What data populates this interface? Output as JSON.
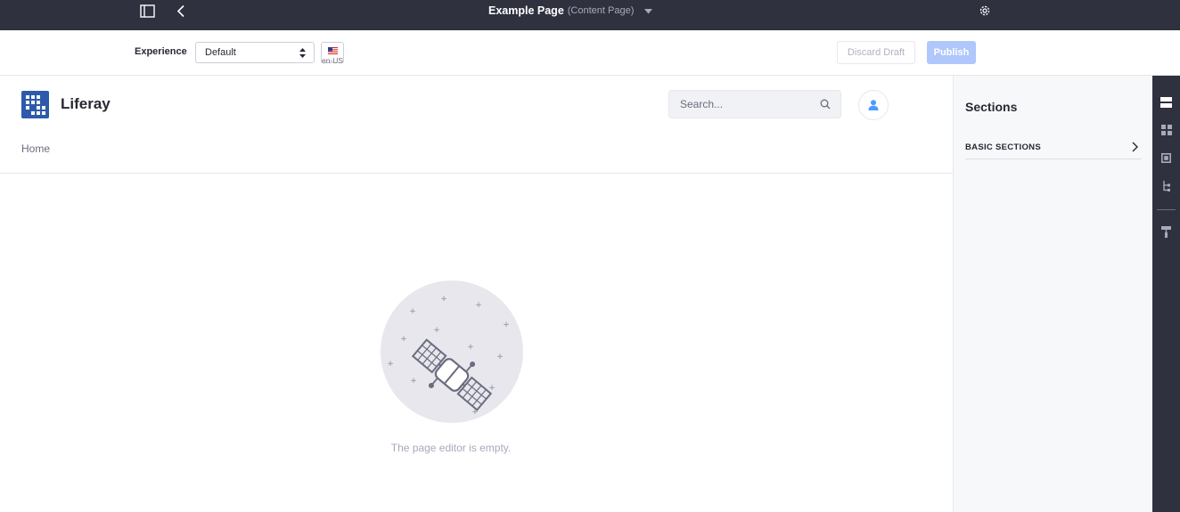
{
  "topbar": {
    "page_title": "Example Page",
    "page_type": "(Content Page)",
    "icons": [
      "sidebar-toggle-icon",
      "back-arrow-icon",
      "caret-down-icon",
      "gear-icon"
    ]
  },
  "toolbar": {
    "experience_label": "Experience",
    "experience_value": "Default",
    "language": "en-US",
    "discard_label": "Discard Draft",
    "publish_label": "Publish"
  },
  "site": {
    "name": "Liferay",
    "search_placeholder": "Search...",
    "breadcrumb_home": "Home"
  },
  "empty_state": {
    "message": "The page editor is empty."
  },
  "sidepanel": {
    "title": "Sections",
    "collapse_label": "BASIC SECTIONS"
  },
  "rail": {
    "icons": [
      "sections-icon",
      "fragments-icon",
      "widgets-icon",
      "page-structure-icon",
      "paint-roller-icon"
    ]
  },
  "colors": {
    "dark_bar": "#30313f",
    "primary_disabled": "#afc7fb",
    "logo_blue": "#2e5aac",
    "avatar_blue": "#4b9bff",
    "muted_text": "#a7a9bc"
  }
}
